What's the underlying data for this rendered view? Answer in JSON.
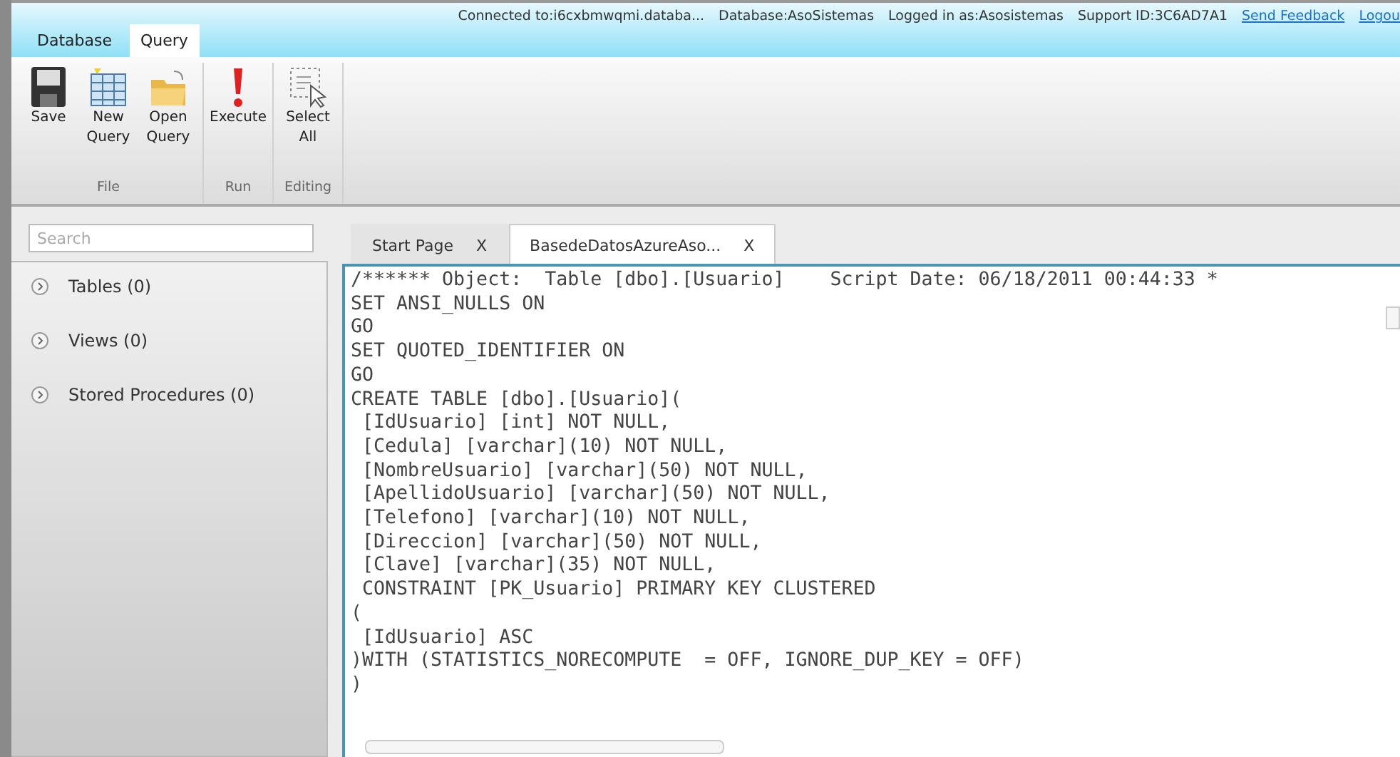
{
  "menu_tabs": [
    {
      "label": "Database",
      "selected": false
    },
    {
      "label": "Query",
      "selected": true
    }
  ],
  "status": {
    "items": [
      "Connected to:i6cxbmwqmi.databa...",
      "Database:AsoSistemas",
      "Logged in as:Asosistemas",
      "Support ID:3C6AD7A1"
    ],
    "links": [
      "Send Feedback",
      "Logou"
    ]
  },
  "ribbon": [
    {
      "label": "File",
      "buttons": [
        {
          "kind": "save",
          "label": "Save"
        },
        {
          "kind": "new",
          "label": "New Query"
        },
        {
          "kind": "open",
          "label": "Open Query"
        }
      ]
    },
    {
      "label": "Run",
      "buttons": [
        {
          "kind": "execute",
          "label": "Execute"
        }
      ]
    },
    {
      "label": "Editing",
      "buttons": [
        {
          "kind": "select",
          "label": "Select All"
        }
      ]
    }
  ],
  "sidebar": {
    "search": {
      "placeholder": "Search"
    },
    "items": [
      {
        "label": "Tables (0)",
        "expanded": false
      },
      {
        "label": "Views (0)",
        "expanded": false
      },
      {
        "label": "Stored Procedures (0)",
        "expanded": false
      }
    ]
  },
  "doc_tabs": [
    {
      "label": "Start Page",
      "close": "X",
      "selected": false
    },
    {
      "label": "BasedeDatosAzureAso...",
      "close": "X",
      "selected": true
    }
  ],
  "editor": {
    "lines": [
      "/****** Object:  Table [dbo].[Usuario]    Script Date: 06/18/2011 00:44:33 *",
      "SET ANSI_NULLS ON",
      "GO",
      "SET QUOTED_IDENTIFIER ON",
      "GO",
      "CREATE TABLE [dbo].[Usuario](",
      "\t[IdUsuario] [int] NOT NULL,",
      "\t[Cedula] [varchar](10) NOT NULL,",
      "\t[NombreUsuario] [varchar](50) NOT NULL,",
      "\t[ApellidoUsuario] [varchar](50) NOT NULL,",
      "\t[Telefono] [varchar](10) NOT NULL,",
      "\t[Direccion] [varchar](50) NOT NULL,",
      "\t[Clave] [varchar](35) NOT NULL,",
      " CONSTRAINT [PK_Usuario] PRIMARY KEY CLUSTERED",
      "(",
      "\t[IdUsuario] ASC",
      ")WITH (STATISTICS_NORECOMPUTE  = OFF, IGNORE_DUP_KEY = OFF)",
      ")"
    ]
  }
}
